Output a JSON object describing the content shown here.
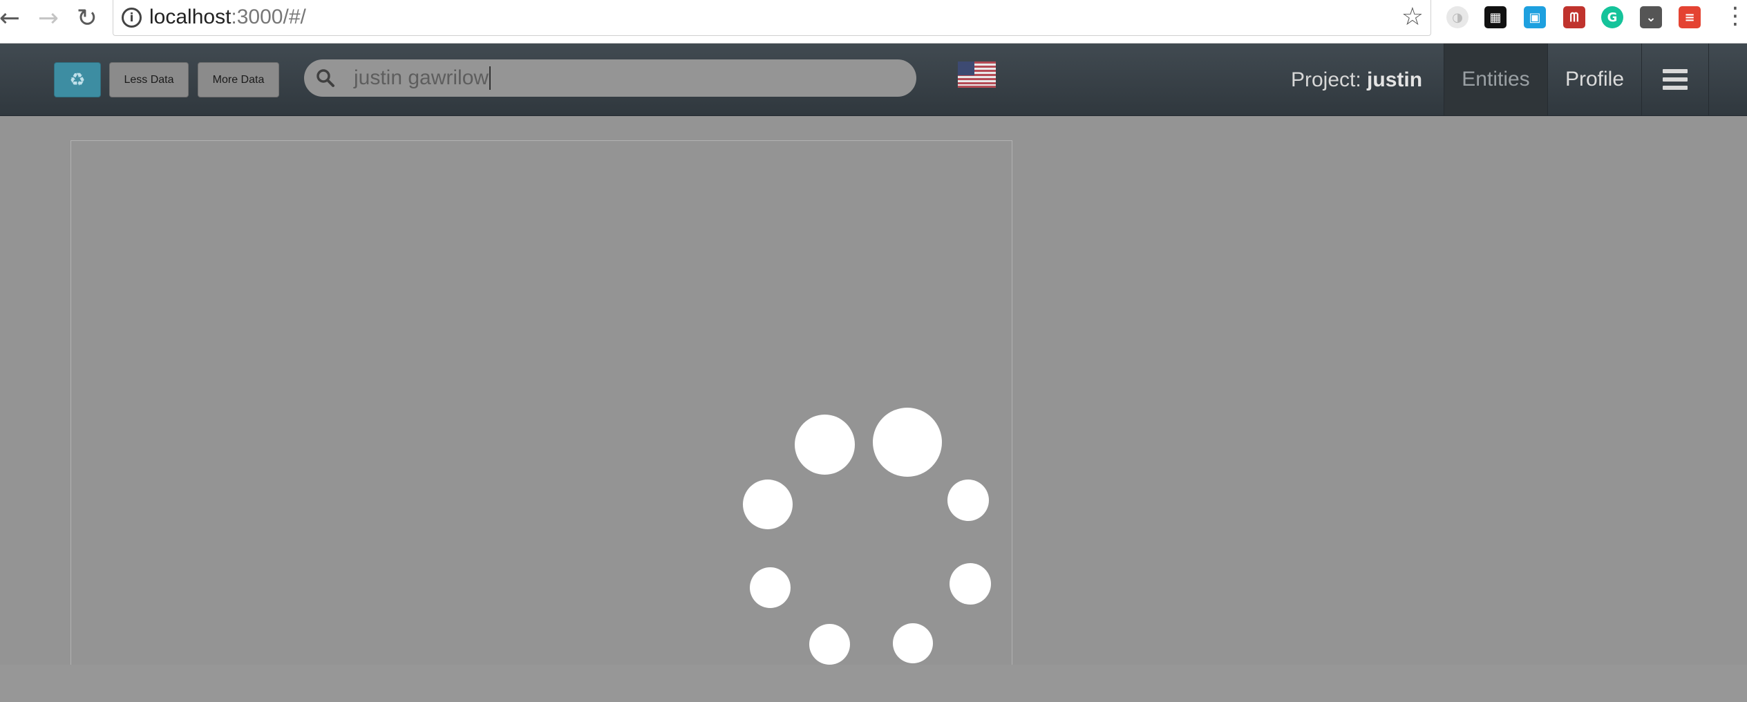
{
  "browser": {
    "url_host": "localhost",
    "url_rest": ":3000/#/"
  },
  "toolbar": {
    "refresh_icon": "♻",
    "less_data_label": "Less Data",
    "more_data_label": "More Data"
  },
  "search": {
    "value": "justin gawrilow"
  },
  "project": {
    "prefix": "Project: ",
    "name": "justin"
  },
  "nav": {
    "entities_label": "Entities",
    "profile_label": "Profile"
  },
  "colors": {
    "navbar": "#363e44",
    "accent": "#3d8da2",
    "overlay": "#949494"
  }
}
